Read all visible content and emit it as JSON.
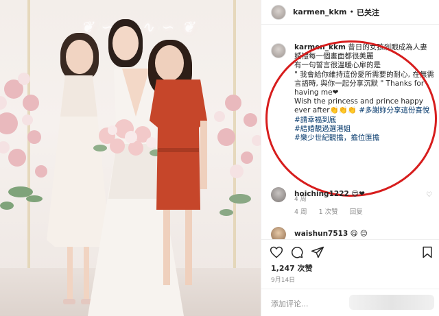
{
  "header": {
    "username": "karmen_kkm",
    "separator": "•",
    "follow_status": "已关注"
  },
  "caption": {
    "username": "karmen_kkm",
    "line_title": " 昔日的女孩剎眼成為人妻",
    "line2": "婚禮每一個畫面都很美麗",
    "line3": "有一句誓言很溫暖心扉的是",
    "line4": "\" 我會給你維持這份愛所需要的耐心, 在無需言語時, 與你一起分享沉默 \" Thanks for having me❤",
    "line5": "Wish the princess and prince happy ever after👏👏👏 ",
    "tag1": "#多謝妳分享這份喜悅",
    "tag2": "#請幸福到底",
    "tag3": "#結婚靚過選港姐",
    "tag4": "#樂少世紀靚擔，擔位匯擔",
    "time": "4 周"
  },
  "comments": [
    {
      "username": "hoiching1222",
      "text": "😍❤",
      "time": "4 周",
      "likes": "1 次赞",
      "reply": "回复"
    },
    {
      "username": "waishun7513",
      "text": "😋 😊"
    }
  ],
  "actions": {
    "like_icon": "heart-icon",
    "comment_icon": "comment-icon",
    "share_icon": "share-icon",
    "save_icon": "bookmark-icon"
  },
  "likes": "1,247 次赞",
  "date": "9月14日",
  "add_comment_placeholder": "添加评论...",
  "colors": {
    "annotation_red": "#d71d1d",
    "hashtag_blue": "#003569",
    "text_dark": "#262626",
    "text_muted": "#8e8e8e",
    "bride_dress": "#f7f3ef",
    "left_dress": "#f6f0ea",
    "right_dress": "#c6462a"
  }
}
